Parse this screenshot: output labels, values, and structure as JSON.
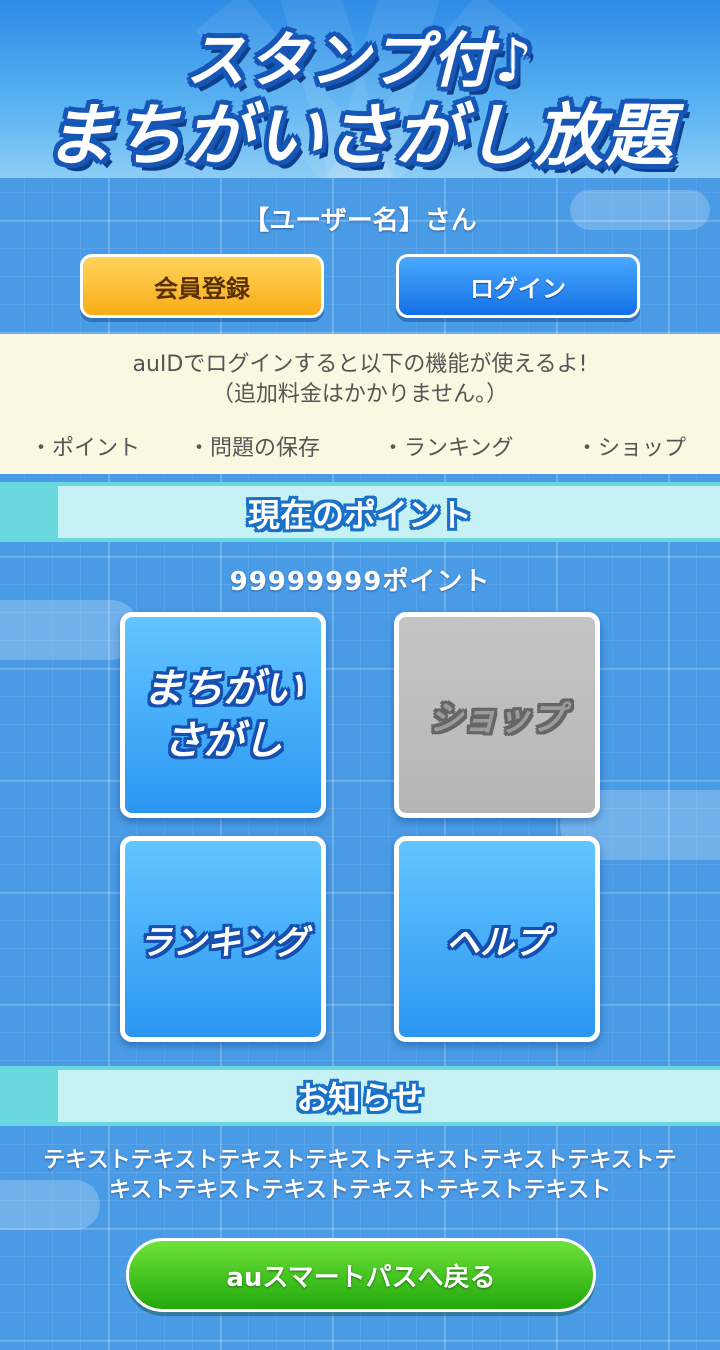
{
  "header": {
    "title_line1": "スタンプ付♪",
    "title_line2": "まちがいさがし放題"
  },
  "user": {
    "name_label": "【ユーザー名】さん",
    "register_label": "会員登録",
    "login_label": "ログイン"
  },
  "info": {
    "line1": "auIDでログインすると以下の機能が使えるよ!",
    "line2": "（追加料金はかかりません。）",
    "features": [
      "・ポイント",
      "・問題の保存",
      "・ランキング",
      "・ショップ"
    ]
  },
  "points_section": {
    "title": "現在のポイント",
    "value": "99999999ポイント"
  },
  "menu": {
    "tiles": [
      {
        "line1": "まちがい",
        "line2": "さがし"
      },
      {
        "label": "ショップ"
      },
      {
        "label": "ランキング"
      },
      {
        "label": "ヘルプ"
      }
    ]
  },
  "news_section": {
    "title": "お知らせ",
    "text": "テキストテキストテキストテキストテキストテキストテキストテキストテキストテキストテキストテキストテキスト"
  },
  "footer": {
    "back_label": "auスマートパスへ戻る"
  },
  "colors": {
    "background": "#4a9be6",
    "register": "#f8ad16",
    "login": "#1470e6",
    "back": "#22a80c",
    "tile_blue": "#2b96f2",
    "tile_disabled": "#b6b6b6"
  }
}
